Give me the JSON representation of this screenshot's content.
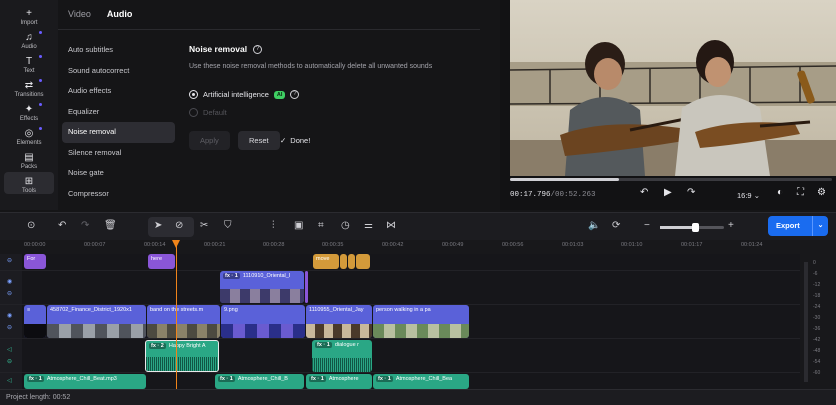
{
  "rail": [
    {
      "icon": "+",
      "label": "Import",
      "dot": false,
      "active": false
    },
    {
      "icon": "♫",
      "label": "Audio",
      "dot": true,
      "active": false
    },
    {
      "icon": "T",
      "label": "Text",
      "dot": true,
      "active": false
    },
    {
      "icon": "⇄",
      "label": "Transitions",
      "dot": true,
      "active": false
    },
    {
      "icon": "✦",
      "label": "Effects",
      "dot": true,
      "active": false
    },
    {
      "icon": "◎",
      "label": "Elements",
      "dot": true,
      "active": false
    },
    {
      "icon": "▤",
      "label": "Packs",
      "dot": false,
      "active": false
    },
    {
      "icon": "⊞",
      "label": "Tools",
      "dot": false,
      "active": true
    }
  ],
  "tabs": [
    "Video",
    "Audio"
  ],
  "active_tab": "Audio",
  "nav": [
    "Auto subtitles",
    "Sound autocorrect",
    "Audio effects",
    "Equalizer",
    "Noise removal",
    "Silence removal",
    "Noise gate",
    "Compressor"
  ],
  "active_nav": "Noise removal",
  "content": {
    "title": "Noise removal",
    "help_icon": "?",
    "description": "Use these noise removal methods to automatically delete all unwanted sounds",
    "options": [
      {
        "label": "Artificial intelligence",
        "badge": "AI",
        "selected": true,
        "enabled": true
      },
      {
        "label": "Default",
        "badge": "",
        "selected": false,
        "enabled": false
      }
    ],
    "apply_label": "Apply",
    "reset_label": "Reset",
    "done_label": "Done!",
    "done_icon": "✓"
  },
  "preview": {
    "current_time": "00:17.796",
    "total_time": "/00:52.263",
    "progress": 0.34,
    "aspect_ratio": "16:9",
    "aspect_chevron": "⌄"
  },
  "toolbar": {
    "export_label": "Export",
    "export_chevron": "⌄"
  },
  "ruler": [
    "00:00:00",
    "00:00:07",
    "00:00:14",
    "00:00:21",
    "00:00:28",
    "00:00:35",
    "00:00:42",
    "00:00:49",
    "00:00:56",
    "00:01:03",
    "00:01:10",
    "00:01:17",
    "00:01:24"
  ],
  "clips": {
    "title_row": [
      {
        "label": "For",
        "fx": ""
      },
      {
        "label": "here",
        "fx": ""
      },
      {
        "label": "move",
        "fx": ""
      }
    ],
    "video_upper": [
      {
        "label": "1110910_Oriental_I",
        "fx": "fx · 1"
      }
    ],
    "video_main": [
      {
        "label": "",
        "fx": "≡"
      },
      {
        "label": "458702_Finance_District_1920x1",
        "fx": ""
      },
      {
        "label": "band on the streets.m",
        "fx": ""
      },
      {
        "label": "9.png",
        "fx": ""
      },
      {
        "label": "1110955_Oriental_Jay",
        "fx": ""
      },
      {
        "label": "person walking in a pa",
        "fx": ""
      }
    ],
    "audio_upper": [
      {
        "label": "Happy Bright A",
        "fx": "fx · 2"
      },
      {
        "label": "dialogue r",
        "fx": "fx · 1"
      }
    ],
    "audio_lower": [
      {
        "label": "Atmosphere_Chill_Beat.mp3",
        "fx": "fx · 1"
      },
      {
        "label": "Atmosphere_Chill_B",
        "fx": "fx · 1"
      },
      {
        "label": "Atmosphere",
        "fx": "fx · 1"
      },
      {
        "label": "Atmosphere_Chill_Bea",
        "fx": "fx · 1"
      }
    ]
  },
  "meter_labels": [
    "0",
    "-6",
    "-12",
    "-18",
    "-24",
    "-30",
    "-36",
    "-42",
    "-48",
    "-54",
    "-60"
  ],
  "status": "Project length: 00:52",
  "colors": {
    "accent": "#1a6cf0",
    "playhead": "#f0841a",
    "video_clip": "#5a61d9",
    "audio_clip": "#2aa785",
    "ai_badge": "#3fcf63"
  }
}
